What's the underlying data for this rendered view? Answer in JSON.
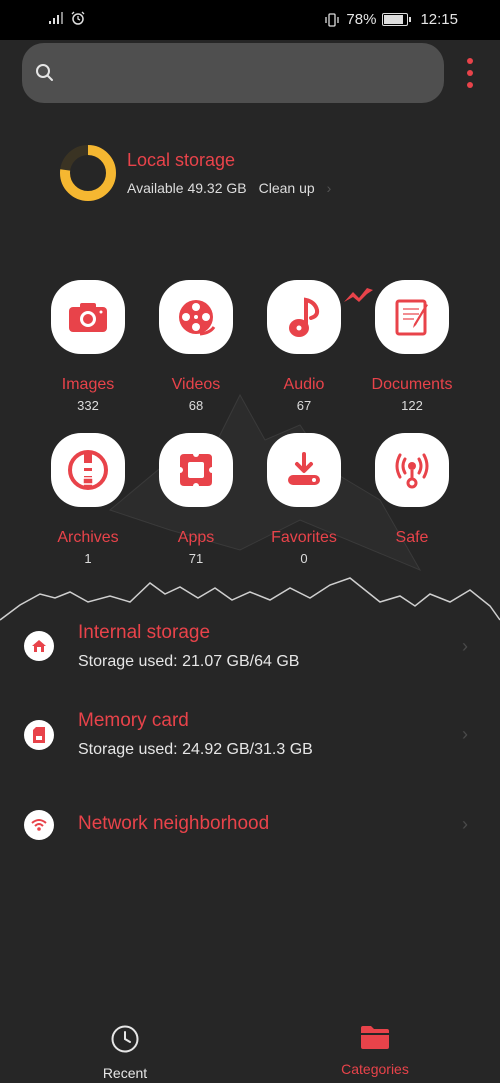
{
  "status": {
    "battery": "78%",
    "time": "12:15",
    "battery_level": 0.78
  },
  "search": {
    "placeholder": ""
  },
  "local_storage": {
    "title": "Local storage",
    "available": "Available 49.32 GB",
    "clean_up": "Clean up",
    "used_fraction": 0.23
  },
  "categories": [
    {
      "label": "Images",
      "count": "332",
      "icon": "camera-icon"
    },
    {
      "label": "Videos",
      "count": "68",
      "icon": "film-reel-icon"
    },
    {
      "label": "Audio",
      "count": "67",
      "icon": "music-note-icon"
    },
    {
      "label": "Documents",
      "count": "122",
      "icon": "document-icon"
    },
    {
      "label": "Archives",
      "count": "1",
      "icon": "archive-icon"
    },
    {
      "label": "Apps",
      "count": "71",
      "icon": "apps-icon"
    },
    {
      "label": "Favorites",
      "count": "0",
      "icon": "download-icon"
    },
    {
      "label": "Safe",
      "count": "",
      "icon": "safe-icon"
    }
  ],
  "storage_list": [
    {
      "title": "Internal storage",
      "subtitle": "Storage used: 21.07 GB/64 GB",
      "icon": "home-icon"
    },
    {
      "title": "Memory card",
      "subtitle": "Storage used: 24.92 GB/31.3 GB",
      "icon": "sd-card-icon"
    },
    {
      "title": "Network neighborhood",
      "subtitle": "",
      "icon": "wifi-icon"
    }
  ],
  "nav": {
    "recent": "Recent",
    "categories": "Categories"
  },
  "colors": {
    "accent": "#e8434a",
    "background": "#262626",
    "ring": "#f5b731"
  }
}
